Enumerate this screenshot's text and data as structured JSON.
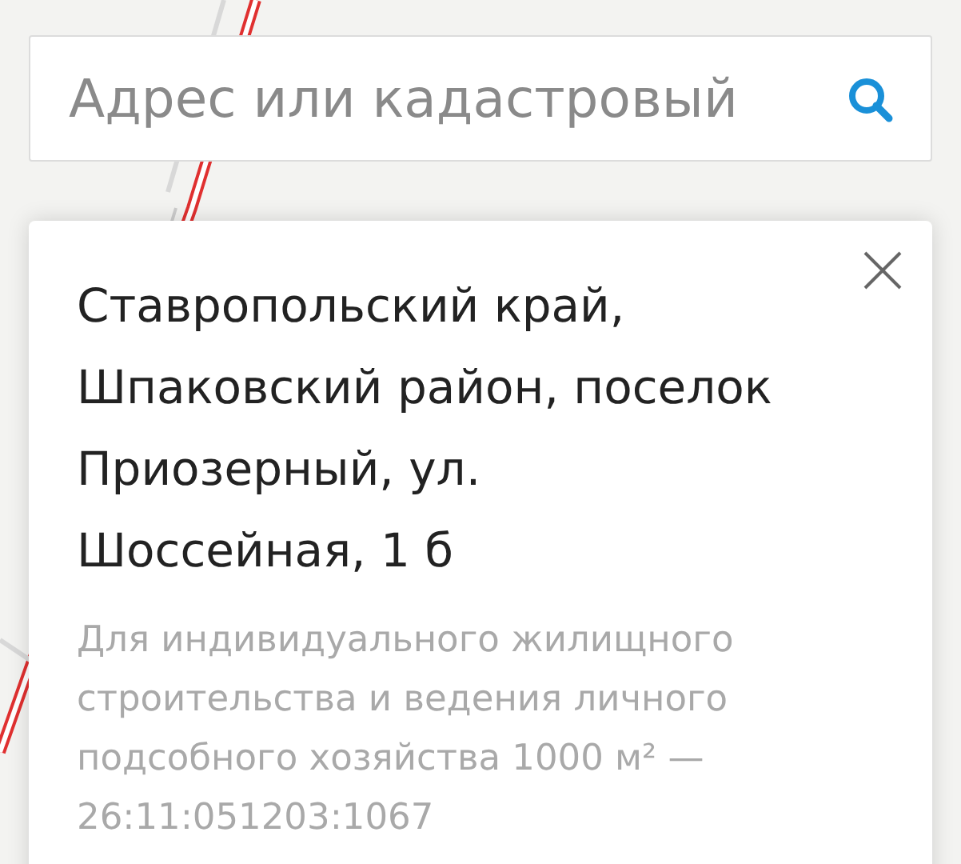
{
  "search": {
    "placeholder": "Адрес или кадастровый"
  },
  "card": {
    "title": "Ставропольский край, Шпаковский район, поселок Приозерный, ул. Шоссейная, 1 б",
    "description": "Для индивидуального жилищного строительства и ведения личного подсобного хозяйства 1000 м² — 26:11:051203:1067"
  }
}
